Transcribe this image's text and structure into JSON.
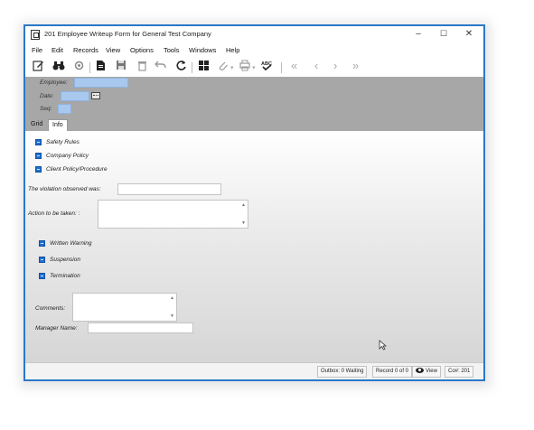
{
  "window": {
    "title": "201 Employee Writeup Form for General Test Company",
    "controls": {
      "minimize": "–",
      "maximize": "☐",
      "close": "✕"
    }
  },
  "menu": [
    "File",
    "Edit",
    "Records",
    "View",
    "Options",
    "Tools",
    "Windows",
    "Help"
  ],
  "toolbar": {
    "icons": [
      "edit-icon",
      "binoculars-icon",
      "settings-icon",
      "document-icon",
      "save-icon",
      "delete-icon",
      "undo-icon",
      "refresh-icon",
      "grid-icon",
      "attach-icon",
      "print-icon",
      "spellcheck-icon",
      "first-record-icon",
      "previous-record-icon",
      "next-record-icon",
      "last-record-icon"
    ],
    "glyphs": {
      "first": "«",
      "prev": "‹",
      "next": "›",
      "last": "»",
      "dropdown": "▾"
    }
  },
  "header": {
    "employee_label": "Employee:",
    "date_label": "Date:",
    "seq_label": "Seq:",
    "employee_value": "",
    "date_value": "",
    "seq_value": ""
  },
  "tabs": [
    {
      "label": "Grid",
      "active": false
    },
    {
      "label": "Info",
      "active": true
    }
  ],
  "form": {
    "policy_checks": [
      "Safety Rules",
      "Company Policy",
      "Client Policy/Procedure"
    ],
    "violation_label": "The violation observed was:",
    "violation_value": "",
    "action_label": "Action to be taken: :",
    "action_value": "",
    "action_checks": [
      "Written Warning",
      "Suspension",
      "Termination"
    ],
    "comments_label": "Comments:",
    "comments_value": "",
    "manager_label": "Manager Name:",
    "manager_value": ""
  },
  "status": {
    "outbox": "Outbox: 0 Waiting",
    "record": "Record 0 of 0",
    "view": "View",
    "company": "Co#: 201"
  },
  "colors": {
    "window_border": "#2b78c8",
    "header_bg": "#a7a7a7",
    "field_bg": "#a9c8ee",
    "checkbox": "#1f6fd1"
  }
}
